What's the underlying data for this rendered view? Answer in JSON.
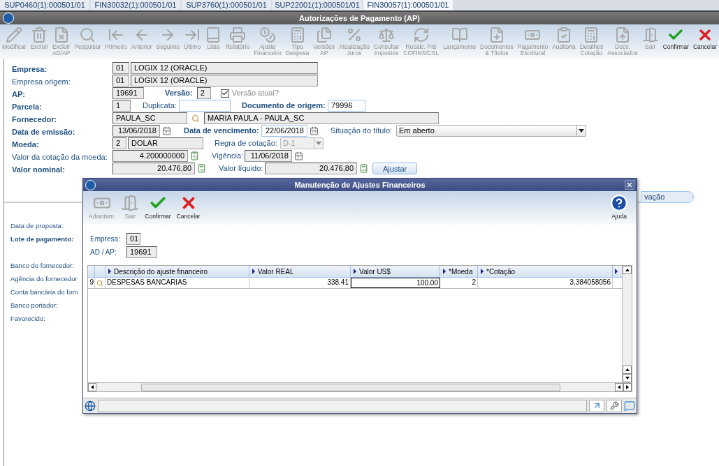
{
  "tabs": [
    {
      "label": "SUP0460(1):000501/01",
      "selected": false
    },
    {
      "label": "FIN30032(1):000501/01",
      "selected": false
    },
    {
      "label": "SUP3760(1):000501/01",
      "selected": false
    },
    {
      "label": "SUP22001(1):000501/01",
      "selected": false
    },
    {
      "label": "FIN30057(1):000501/01",
      "selected": true
    }
  ],
  "window": {
    "title": "Autorizações de Pagamento (AP)"
  },
  "toolbar": [
    {
      "lines": [
        "Modificar"
      ],
      "disabled": true
    },
    {
      "lines": [
        "Excluir"
      ],
      "disabled": true
    },
    {
      "lines": [
        "Excluir",
        "AD/AP"
      ],
      "disabled": true
    },
    {
      "lines": [
        "Pesquisar"
      ],
      "disabled": true
    },
    {
      "lines": [
        "Primeiro"
      ],
      "disabled": true
    },
    {
      "lines": [
        "Anterior"
      ],
      "disabled": true
    },
    {
      "lines": [
        "Seguinte"
      ],
      "disabled": true
    },
    {
      "lines": [
        "Último"
      ],
      "disabled": true
    },
    {
      "lines": [
        "Lista"
      ],
      "disabled": true
    },
    {
      "lines": [
        "Relatório"
      ],
      "disabled": true
    },
    {
      "lines": [
        "Ajuste",
        "Financeiro"
      ],
      "disabled": true
    },
    {
      "lines": [
        "Tipo",
        "Despesa"
      ],
      "disabled": true
    },
    {
      "lines": [
        "Versões",
        "AP"
      ],
      "disabled": true
    },
    {
      "lines": [
        "Atualização",
        "Juros"
      ],
      "disabled": true
    },
    {
      "lines": [
        "Consultar",
        "Impostos"
      ],
      "disabled": true
    },
    {
      "lines": [
        "Recalc. PIS",
        "COFINS/CSL"
      ],
      "disabled": true
    },
    {
      "lines": [
        "Lançamento"
      ],
      "disabled": true
    },
    {
      "lines": [
        "Documentos",
        "& Títulos"
      ],
      "disabled": true
    },
    {
      "lines": [
        "Pagamento",
        "Escritural"
      ],
      "disabled": true
    },
    {
      "lines": [
        "Auditoria"
      ],
      "disabled": true
    },
    {
      "lines": [
        "Detalhes",
        "Cotação"
      ],
      "disabled": true
    },
    {
      "lines": [
        "Docs.",
        "Associados"
      ],
      "disabled": true
    },
    {
      "lines": [
        "Sair"
      ],
      "disabled": true
    },
    {
      "lines": [
        "Confirmar"
      ],
      "disabled": false
    },
    {
      "lines": [
        "Cancelar"
      ],
      "disabled": false
    }
  ],
  "form": {
    "empresa": {
      "label": "Empresa:",
      "bold": true,
      "code": "01",
      "name": "LOGIX 12 (ORACLE)"
    },
    "empresa_origem": {
      "label": "Empresa origem:",
      "bold": false,
      "code": "01",
      "name": "LOGIX 12 (ORACLE)"
    },
    "ap": {
      "label": "AP:",
      "bold": true,
      "value": "19691",
      "editable": false
    },
    "versao": {
      "label": "Versão:",
      "bold": true,
      "value": "2",
      "editable": false
    },
    "versao_atual": {
      "label": "Versão atual?",
      "checked": true,
      "disabled": true
    },
    "parcela": {
      "label": "Parcela:",
      "bold": true,
      "value": "1",
      "editable": false
    },
    "duplicata": {
      "label": "Duplicata:",
      "bold": false,
      "editable": true
    },
    "documento_origem": {
      "label": "Documento de origem:",
      "bold": true,
      "value": "79996",
      "editable": true
    },
    "fornecedor": {
      "label": "Fornecedor:",
      "bold": true,
      "code": "PAULA_SC",
      "name": "MARIA PAULA - PAULA_SC"
    },
    "data_emissao": {
      "label": "Data de emissão:",
      "bold": true,
      "value": "13/06/2018",
      "editable": false
    },
    "data_vencimento": {
      "label": "Data de vencimento:",
      "bold": true,
      "value": "22/06/2018",
      "editable": true
    },
    "situacao_titulo": {
      "label": "Situação do título:",
      "bold": false,
      "value": "Em aberto",
      "disabled": false
    },
    "moeda": {
      "label": "Moeda:",
      "bold": true,
      "code": "2",
      "name": "DOLAR"
    },
    "regra_cotacao": {
      "label": "Regra de cotação:",
      "bold": false,
      "value": "D-1",
      "disabled": true
    },
    "valor_cotacao": {
      "label": "Valor da cotação da moeda:",
      "bold": false,
      "value": "4.200000000",
      "editable": false
    },
    "vigencia": {
      "label": "Vigência:",
      "bold": false,
      "value": "11/06/2018",
      "editable": false
    },
    "valor_nominal": {
      "label": "Valor nominal:",
      "bold": true,
      "value": "20.476,80",
      "editable": false
    },
    "valor_liquido": {
      "label": "Valor líquido:",
      "bold": false,
      "value": "20.476,80",
      "editable": false
    },
    "ajustar_button": "Ajustar"
  },
  "section_tab": {
    "label": "vação",
    "selected": false
  },
  "lower_labels": [
    {
      "text": "Data de proposta:",
      "bold": false
    },
    {
      "text": "Lote de pagamento:",
      "bold": true
    },
    {
      "text": "Banco do fornecedor:",
      "bold": false
    },
    {
      "text": "Agência do fornecedor",
      "bold": false
    },
    {
      "text": "Conta bancária do forn",
      "bold": false
    },
    {
      "text": "Banco portador:",
      "bold": false
    },
    {
      "text": "Favorecido:",
      "bold": false
    }
  ],
  "dialog": {
    "title": "Manutenção de Ajustes Financeiros",
    "toolbar": [
      {
        "label": "Adiantam.",
        "disabled": true
      },
      {
        "label": "Sair",
        "disabled": true
      },
      {
        "label": "Confirmar",
        "disabled": false
      },
      {
        "label": "Cancelar",
        "disabled": false
      }
    ],
    "help": "Ajuda",
    "empresa": {
      "label": "Empresa:",
      "value": "01"
    },
    "ad_ap": {
      "label": "AD / AP:",
      "value": "19691"
    },
    "table": {
      "columns": [
        "Descrição do ajuste financeiro",
        "Valor REAL",
        "Valor US$",
        "*Moeda",
        "*Cotação"
      ],
      "rows": [
        {
          "number": "9",
          "cells": [
            {
              "text": "DESPESAS BANCARIAS",
              "focused": false
            },
            {
              "text": "338.41",
              "focused": false
            },
            {
              "text": "100.00",
              "focused": true
            },
            {
              "text": "2",
              "focused": false
            },
            {
              "text": "3.384058056",
              "focused": false
            }
          ]
        }
      ]
    }
  }
}
